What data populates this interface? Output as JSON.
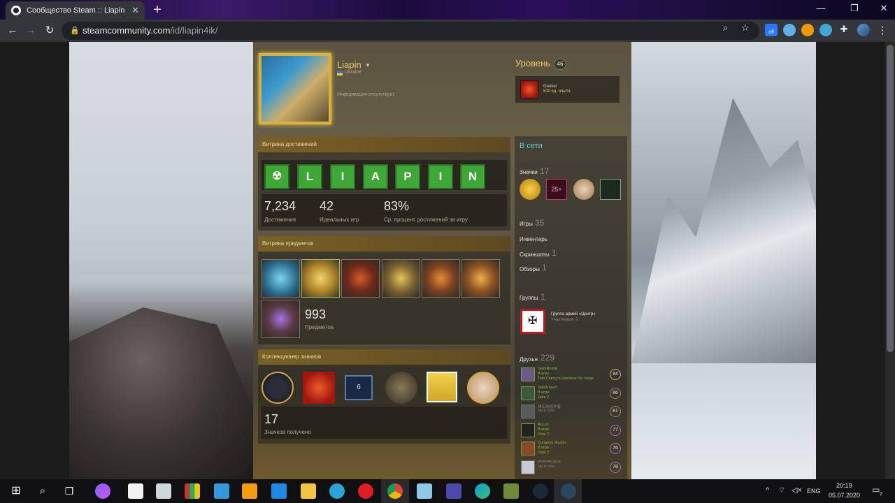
{
  "browser": {
    "tab_title": "Сообщество Steam :: Liapin",
    "new_tab": "+",
    "url_host": "steamcommunity.com",
    "url_path": "/id/liapin4ik/",
    "extension_label": "off"
  },
  "profile": {
    "persona_name": "Liapin",
    "country": "Ukraine",
    "summary": "Информация отсутствует.",
    "level_title": "Уровень",
    "level": "46",
    "fav_badge_name": "Ganker",
    "fav_badge_xp": "500 ед. опыта"
  },
  "achievement_showcase": {
    "title": "Витрина достижений",
    "letters": [
      "L",
      "I",
      "A",
      "P",
      "I",
      "N"
    ],
    "stats": [
      {
        "value": "7,234",
        "label": "Достижения"
      },
      {
        "value": "42",
        "label": "Идеальных игр"
      },
      {
        "value": "83%",
        "label": "Ср. процент достижений за игру"
      }
    ]
  },
  "item_showcase": {
    "title": "Витрина предметов",
    "count": "993",
    "count_label": "Предметов"
  },
  "badge_collector": {
    "title": "Коллекционер значков",
    "count": "17",
    "count_label": "Значков получено",
    "steam_badge_number": "6"
  },
  "right_column": {
    "status": "В сети",
    "badges_label": "Значки",
    "badges_count": "17",
    "badge_25": "25+",
    "games_label": "Игры",
    "games_count": "35",
    "inventory_label": "Инвентарь",
    "screenshots_label": "Скриншоты",
    "screenshots_count": "1",
    "reviews_label": "Обзоры",
    "reviews_count": "1",
    "groups_label": "Группы",
    "groups_count": "1",
    "group_name": "Группа армий «Центр»",
    "group_members": "Участников: 3",
    "friends_label": "Друзья",
    "friends_count": "229",
    "friends": [
      {
        "name": "SaintRomik",
        "status": "В игре",
        "game": "Tom Clancy's Rainbow Six Siege",
        "level": "94"
      },
      {
        "name": "JohnKhach",
        "status": "В игре",
        "game": "Dota 2",
        "level": "86"
      },
      {
        "name": "快乐的初学者",
        "status": "Не в сети",
        "game": "",
        "level": "81"
      },
      {
        "name": "AnLuc",
        "status": "В игре",
        "game": "Dota 2",
        "level": "77"
      },
      {
        "name": "Dungeon Master",
        "status": "В игре",
        "game": "Dota 2",
        "level": "76"
      },
      {
        "name": "ploBo4ku))))))",
        "status": "Не в сети",
        "game": "",
        "level": "76"
      }
    ]
  },
  "taskbar": {
    "lang": "ENG",
    "time": "20:19",
    "date": "05.07.2020",
    "notifications": "2"
  },
  "colors": {
    "accent_gold": "#e6c765",
    "online_blue": "#57cbde",
    "achievement_green": "#3ea836",
    "ingame_green": "#90ba3c"
  }
}
